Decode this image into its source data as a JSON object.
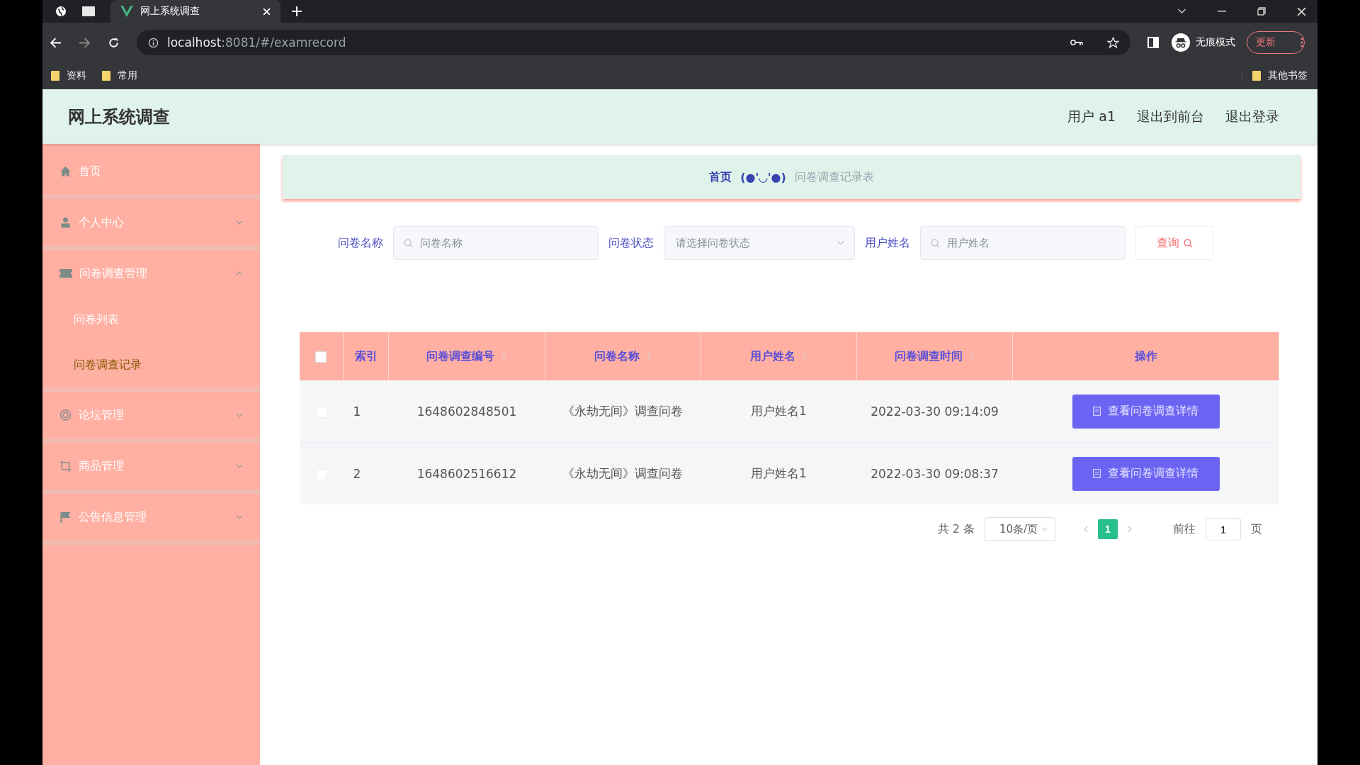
{
  "browser": {
    "tabs": [
      {
        "title": "网上系统调查",
        "selected": true
      }
    ],
    "url_host": "localhost",
    "url_rest": ":8081/#/examrecord",
    "profile_label": "无痕模式",
    "update_button": "更新",
    "bookmarks": [
      "资料",
      "常用"
    ],
    "other_bookmarks": "其他书签"
  },
  "header": {
    "title": "网上系统调查",
    "links": [
      "用户 a1",
      "退出到前台",
      "退出登录"
    ]
  },
  "sidebar": {
    "items": [
      {
        "label": "首页",
        "selected": false
      },
      {
        "label": "个人中心",
        "expanded": false,
        "selected": false
      },
      {
        "label": "问卷调查管理",
        "expanded": true,
        "selected": false,
        "children": [
          {
            "label": "问卷列表",
            "selected": false
          },
          {
            "label": "问卷调查记录",
            "selected": true
          }
        ]
      },
      {
        "label": "论坛管理",
        "expanded": false,
        "selected": false
      },
      {
        "label": "商品管理",
        "expanded": false,
        "selected": false
      },
      {
        "label": "公告信息管理",
        "expanded": false,
        "selected": false
      }
    ]
  },
  "breadcrumb": {
    "home": "首页",
    "emoticon": "(●'◡'●)",
    "current": "问卷调查记录表"
  },
  "search": {
    "fields": [
      {
        "kind": "input",
        "label": "问卷名称",
        "placeholder": "问卷名称"
      },
      {
        "kind": "select",
        "label": "问卷状态",
        "placeholder": "请选择问卷状态"
      },
      {
        "kind": "input",
        "label": "用户姓名",
        "placeholder": "用户姓名"
      }
    ],
    "button": "查询"
  },
  "table": {
    "all_checked": false,
    "columns": [
      {
        "label": "索引",
        "sortable": false
      },
      {
        "label": "问卷调查编号",
        "sortable": true
      },
      {
        "label": "问卷名称",
        "sortable": true
      },
      {
        "label": "用户姓名",
        "sortable": true
      },
      {
        "label": "问卷调查时间",
        "sortable": true
      },
      {
        "label": "操作",
        "sortable": false
      }
    ],
    "rows": [
      {
        "checked": false,
        "cells": [
          "1",
          "1648602848501",
          "《永劫无间》调查问卷",
          "用户姓名1",
          "2022-03-30 09:14:09"
        ],
        "action": "查看问卷调查详情"
      },
      {
        "checked": false,
        "cells": [
          "2",
          "1648602516612",
          "《永劫无间》调查问卷",
          "用户姓名1",
          "2022-03-30 09:08:37"
        ],
        "action": "查看问卷调查详情"
      }
    ]
  },
  "pagination": {
    "total": "共 2 条",
    "page_size": "10条/页",
    "pages": [
      {
        "label": "1",
        "selected": true
      }
    ],
    "goto_label": "前往",
    "goto_value": "1",
    "page_unit": "页"
  }
}
